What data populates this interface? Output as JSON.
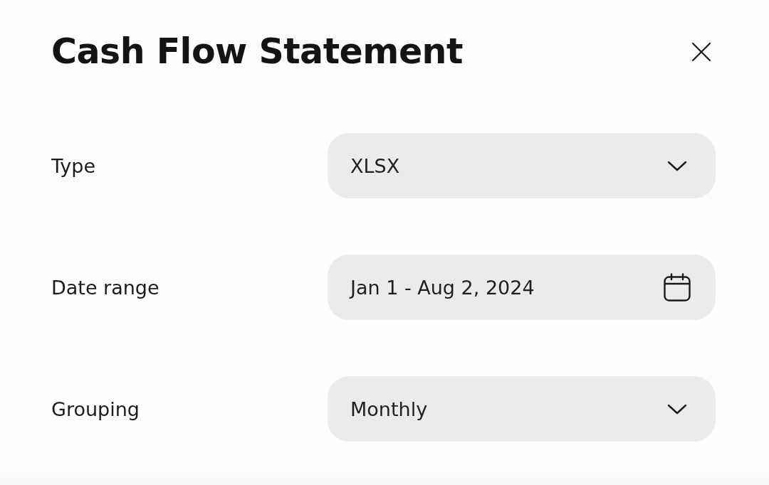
{
  "dialog": {
    "title": "Cash Flow Statement"
  },
  "fields": [
    {
      "label": "Type",
      "kind": "dropdown",
      "value": "XLSX"
    },
    {
      "label": "Date range",
      "kind": "date",
      "value": "Jan 1 - Aug 2, 2024"
    },
    {
      "label": "Grouping",
      "kind": "dropdown",
      "value": "Monthly"
    }
  ]
}
